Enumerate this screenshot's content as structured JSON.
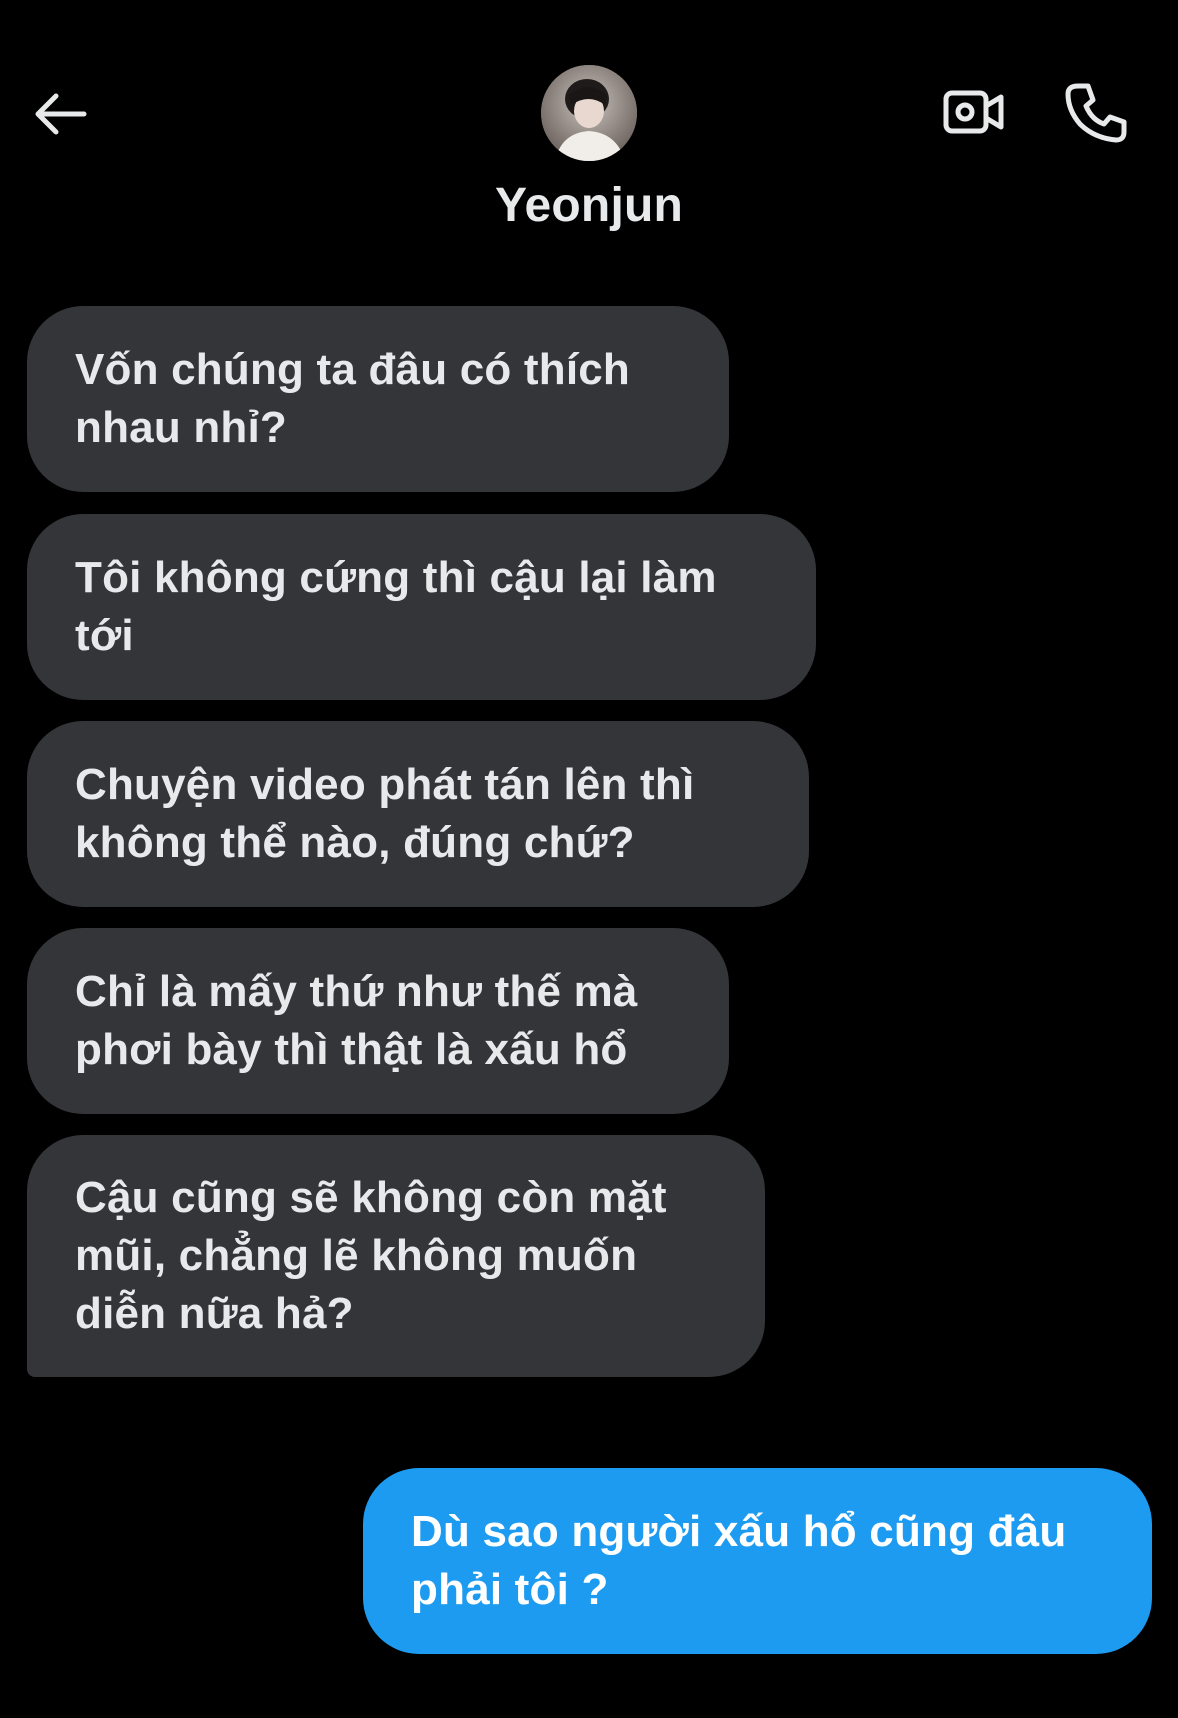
{
  "header": {
    "back_icon": "arrow-left-icon",
    "contact_name": "Yeonjun",
    "video_icon": "video-camera-icon",
    "call_icon": "phone-icon"
  },
  "colors": {
    "background": "#000000",
    "incoming_bubble": "#333539",
    "outgoing_bubble": "#1d9bf0",
    "text": "#e7e9ea"
  },
  "messages": [
    {
      "direction": "incoming",
      "text": "Vốn chúng ta đâu có thích nhau nhỉ?"
    },
    {
      "direction": "incoming",
      "text": "Tôi không cứng thì cậu lại làm tới"
    },
    {
      "direction": "incoming",
      "text": "Chuyện video phát tán lên thì không thể nào, đúng chứ?"
    },
    {
      "direction": "incoming",
      "text": "Chỉ là mấy thứ như thế mà phơi bày thì thật là xấu hổ"
    },
    {
      "direction": "incoming",
      "text": "Cậu cũng sẽ không còn mặt mũi, chẳng lẽ không muốn diễn nữa hả?"
    },
    {
      "direction": "outgoing",
      "text": "Dù sao người xấu hổ cũng đâu phải tôi ?"
    }
  ]
}
